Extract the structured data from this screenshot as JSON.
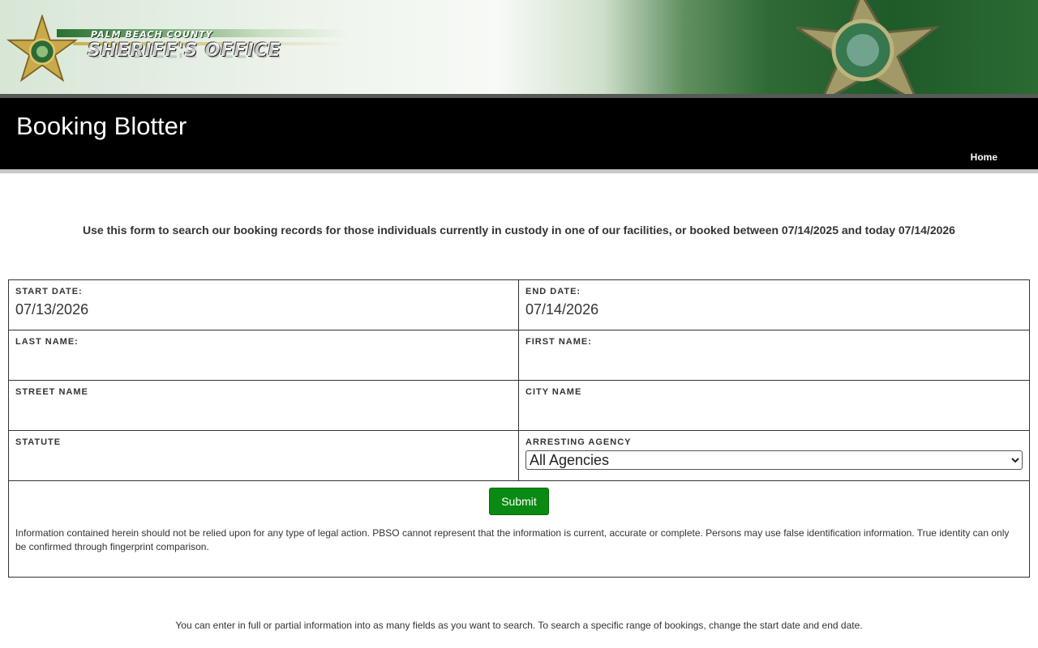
{
  "banner": {
    "county": "PALM BEACH COUNTY",
    "office": "SHERIFF'S OFFICE"
  },
  "header": {
    "title": "Booking Blotter",
    "home_link": "Home"
  },
  "intro": {
    "text": "Use this form to search our booking records for those individuals currently in custody in one of our facilities, or booked between 07/14/2025 and today 07/14/2026"
  },
  "form": {
    "start_date": {
      "label": "START DATE:",
      "value": "07/13/2026"
    },
    "end_date": {
      "label": "END DATE:",
      "value": "07/14/2026"
    },
    "last_name": {
      "label": "LAST NAME:",
      "value": ""
    },
    "first_name": {
      "label": "FIRST NAME:",
      "value": ""
    },
    "street_name": {
      "label": "STREET NAME",
      "value": ""
    },
    "city_name": {
      "label": "CITY NAME",
      "value": ""
    },
    "statute": {
      "label": "STATUTE",
      "value": ""
    },
    "arresting_agency": {
      "label": "ARRESTING AGENCY",
      "selected": "All Agencies"
    },
    "submit_label": "Submit",
    "disclaimer": "Information contained herein should not be relied upon for any type of legal action. PBSO cannot represent that the information is current, accurate or complete. Persons may use false identification information. True identity can only be confirmed through fingerprint comparison."
  },
  "footer": {
    "help": "You can enter in full or partial information into as many fields as you want to search. To search a specific range of bookings, change the start date and end date."
  },
  "colors": {
    "header_bg": "#000000",
    "submit_bg": "#0a8a12",
    "banner_green": "#2f6a36"
  }
}
